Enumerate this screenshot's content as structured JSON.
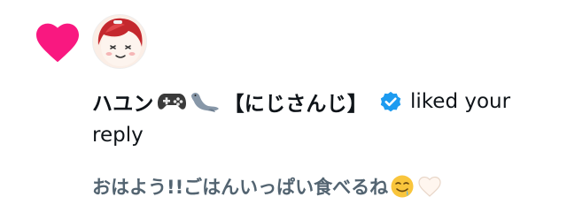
{
  "notification": {
    "type_icon": "heart-icon",
    "avatar": "avatar",
    "user": {
      "name_part1": "ハユン",
      "name_part2": "【にじさんじ】",
      "emoji_after_name": [
        "gamepad-icon",
        "seal-icon"
      ],
      "verified": true
    },
    "action_text": "liked your",
    "action_text_wrap": "reply",
    "reply_text": "おはよう!!ごはんいっぱい食べるね",
    "reply_emoji": [
      "drooling-face-icon",
      "white-heart-icon"
    ]
  },
  "colors": {
    "like_pink": "#f91880",
    "verified_blue": "#1d9bf0",
    "primary_text": "#0f1419",
    "secondary_text": "#536471"
  }
}
